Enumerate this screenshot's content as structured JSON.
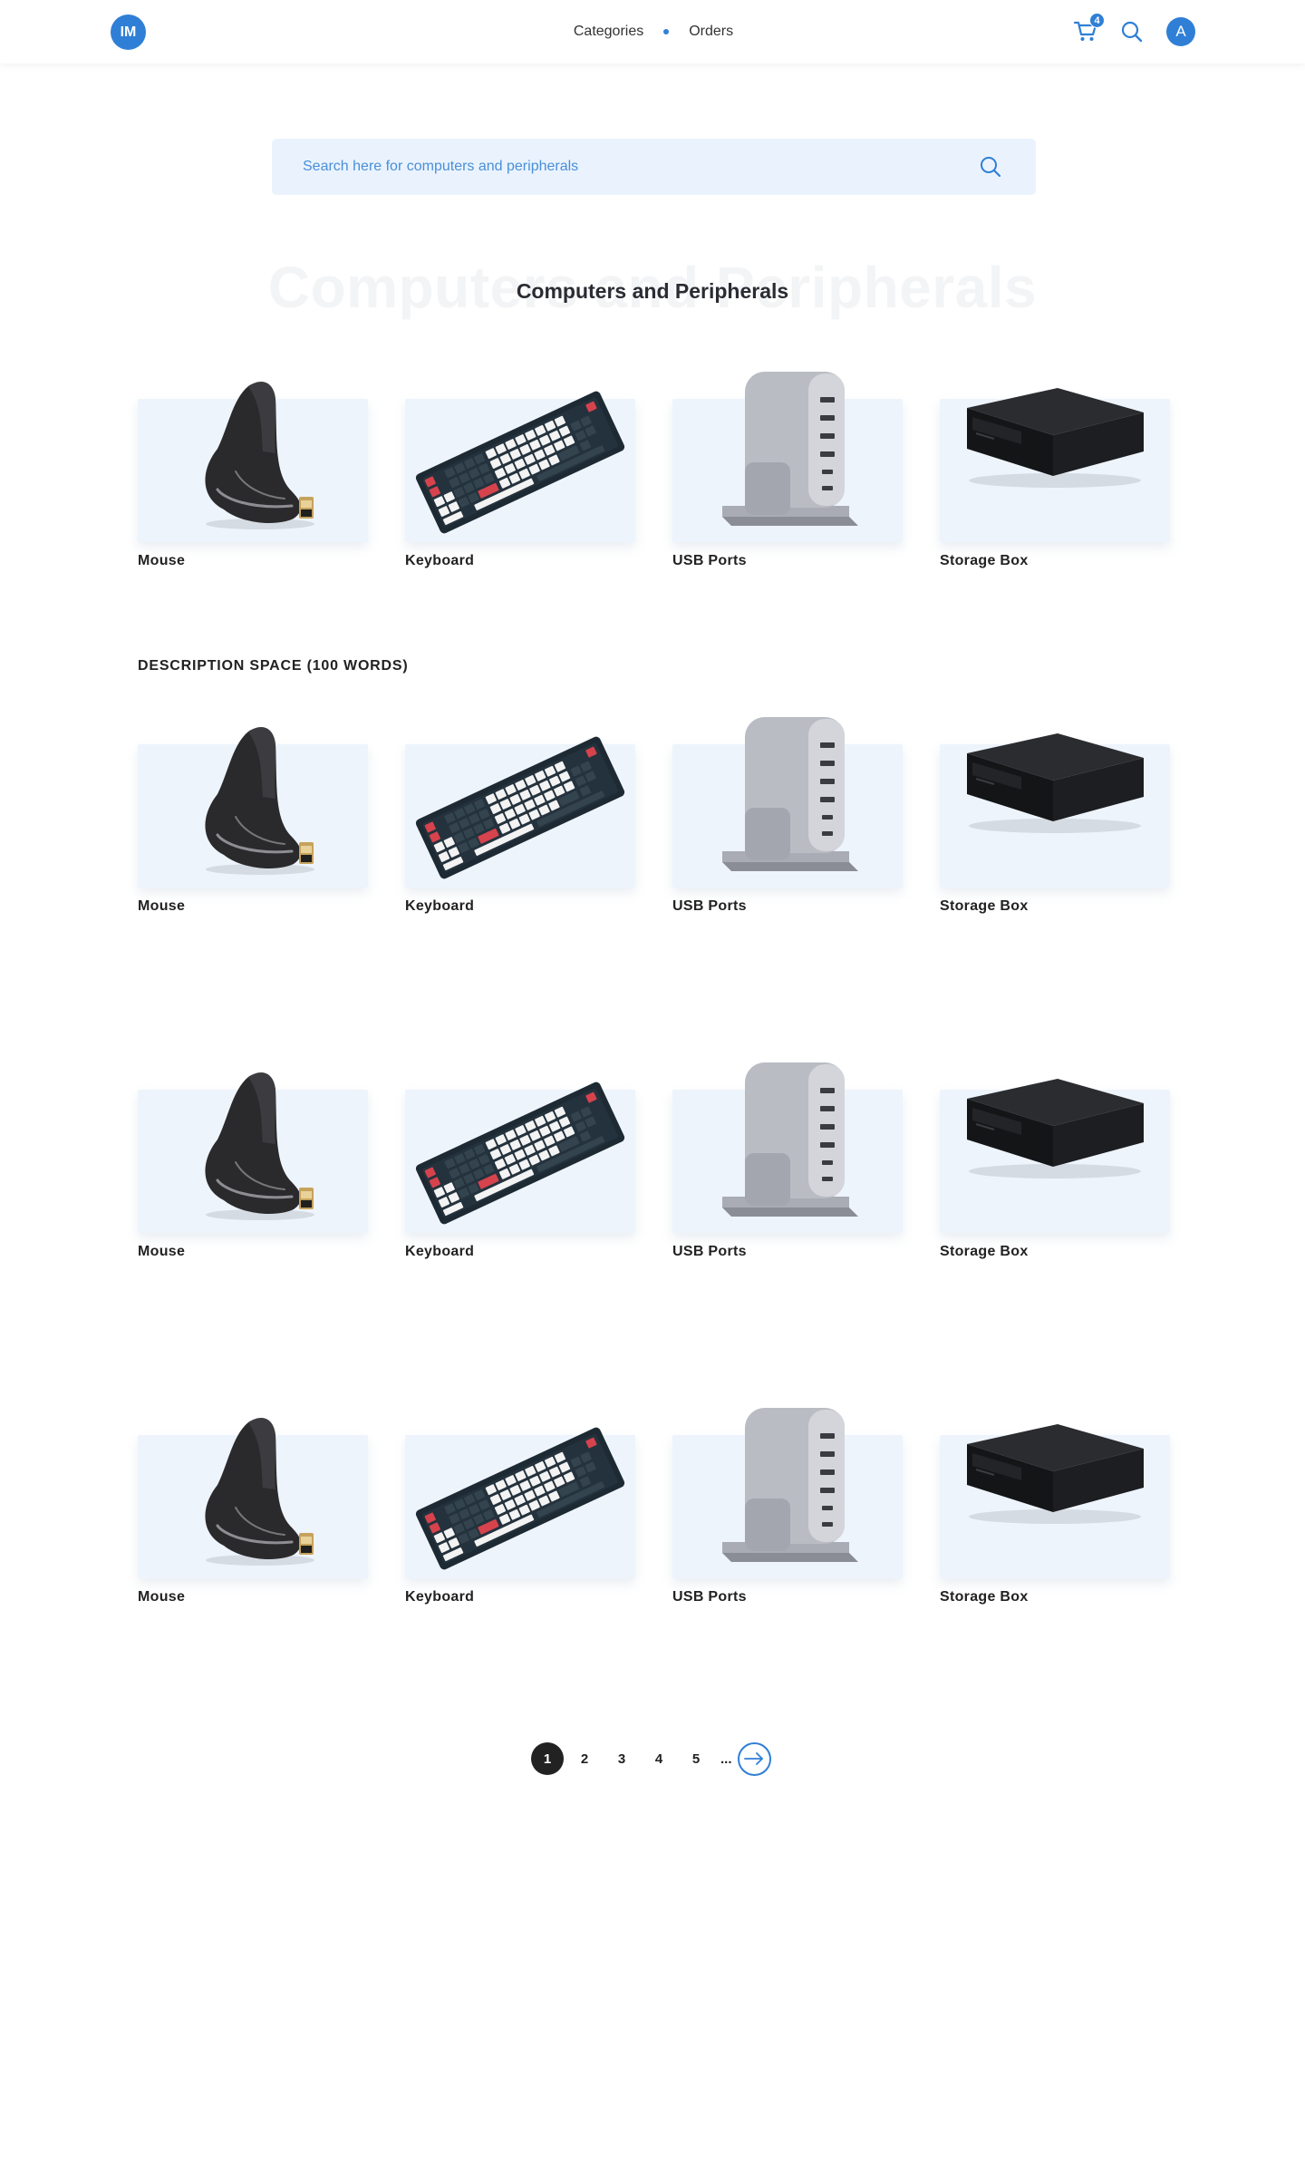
{
  "header": {
    "logo": "IM",
    "nav": [
      {
        "label": "Categories"
      },
      {
        "label": "Orders"
      }
    ],
    "cart_count": "4",
    "avatar_initial": "A"
  },
  "search": {
    "placeholder": "Search here for computers and peripherals"
  },
  "page": {
    "title_ghost": "Computers and Peripherals",
    "title": "Computers and Peripherals",
    "description": "DESCRIPTION SPACE (100 WORDS)"
  },
  "rows": [
    {
      "products": [
        {
          "label": "Mouse",
          "icon": "mouse-image"
        },
        {
          "label": "Keyboard",
          "icon": "keyboard-image"
        },
        {
          "label": "USB Ports",
          "icon": "usb-hub-image"
        },
        {
          "label": "Storage Box",
          "icon": "storage-box-image"
        }
      ]
    },
    {
      "products": [
        {
          "label": "Mouse",
          "icon": "mouse-image"
        },
        {
          "label": "Keyboard",
          "icon": "keyboard-image"
        },
        {
          "label": "USB Ports",
          "icon": "usb-hub-image"
        },
        {
          "label": "Storage Box",
          "icon": "storage-box-image"
        }
      ]
    },
    {
      "products": [
        {
          "label": "Mouse",
          "icon": "mouse-image"
        },
        {
          "label": "Keyboard",
          "icon": "keyboard-image"
        },
        {
          "label": "USB Ports",
          "icon": "usb-hub-image"
        },
        {
          "label": "Storage Box",
          "icon": "storage-box-image"
        }
      ]
    },
    {
      "products": [
        {
          "label": "Mouse",
          "icon": "mouse-image"
        },
        {
          "label": "Keyboard",
          "icon": "keyboard-image"
        },
        {
          "label": "USB Ports",
          "icon": "usb-hub-image"
        },
        {
          "label": "Storage Box",
          "icon": "storage-box-image"
        }
      ]
    }
  ],
  "pagination": {
    "pages": [
      "1",
      "2",
      "3",
      "4",
      "5"
    ],
    "current": "1",
    "ellipsis": "..."
  },
  "colors": {
    "accent": "#2f7fd6",
    "card_bg": "#eef4fc",
    "search_bg": "#eaf3fd"
  }
}
